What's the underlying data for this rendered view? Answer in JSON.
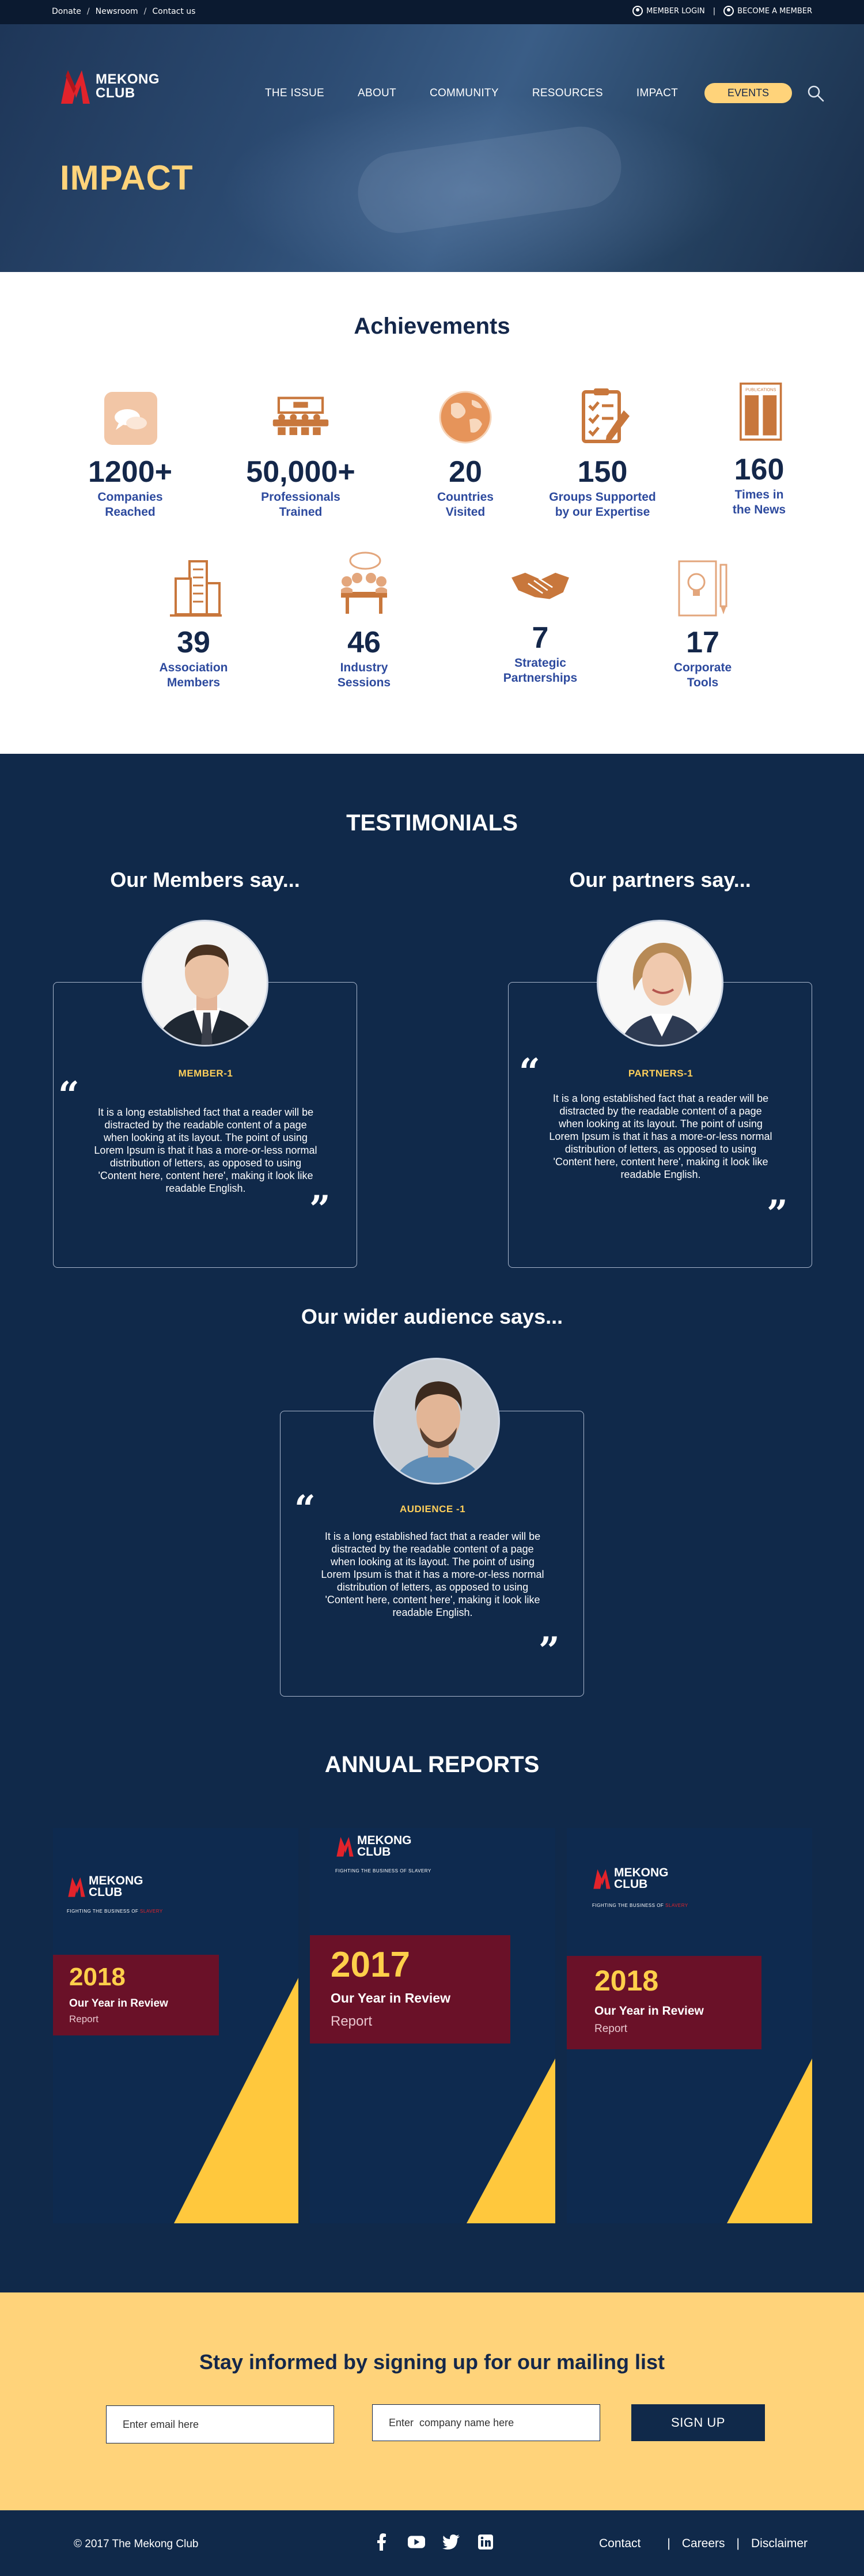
{
  "topbar": {
    "donate": "Donate",
    "newsroom": "Newsroom",
    "contact": "Contact us",
    "sep": "/",
    "member_login": "MEMBER LOGIN",
    "become_member": "BECOME A MEMBER",
    "pipe": "|"
  },
  "brand": {
    "line1": "MEKONG",
    "line2": "CLUB",
    "tagline_prefix": "FIGHTING THE BUSINESS OF",
    "tagline_accent": "SLAVERY",
    "color_red": "#e2232b"
  },
  "nav": {
    "items": [
      "THE ISSUE",
      "ABOUT",
      "COMMUNITY",
      "RESOURCES",
      "IMPACT"
    ],
    "events": "EVENTS"
  },
  "hero": {
    "title": "IMPACT"
  },
  "achievements": {
    "title": "Achievements",
    "stats": [
      {
        "number": "1200+",
        "label1": "Companies",
        "label2": "Reached",
        "icon": "chat-bubbles-icon"
      },
      {
        "number": "50,000+",
        "label1": "Professionals",
        "label2": "Trained",
        "icon": "training-board-icon"
      },
      {
        "number": "20",
        "label1": "Countries",
        "label2": "Visited",
        "icon": "globe-icon"
      },
      {
        "number": "150",
        "label1": "Groups Supported",
        "label2": "by our Expertise",
        "icon": "checklist-icon"
      },
      {
        "number": "160",
        "label1": "Times in",
        "label2": "the News",
        "icon": "publications-icon",
        "icon_text": "PUBLICATIONS"
      },
      {
        "number": "39",
        "label1": "Association",
        "label2": "Members",
        "icon": "buildings-icon"
      },
      {
        "number": "46",
        "label1": "Industry",
        "label2": "Sessions",
        "icon": "meeting-icon"
      },
      {
        "number": "7",
        "label1": "Strategic",
        "label2": "Partnerships",
        "icon": "handshake-icon"
      },
      {
        "number": "17",
        "label1": "Corporate",
        "label2": "Tools",
        "icon": "idea-tools-icon"
      }
    ]
  },
  "testimonials": {
    "title": "TESTIMONIALS",
    "members_heading": "Our Members say...",
    "partners_heading": "Our partners say...",
    "audience_heading": "Our wider audience says...",
    "quote_lines": [
      "It is a long established fact that a reader will be",
      "distracted by the readable content of a page",
      "when looking at its layout. The point of using",
      "Lorem Ipsum is that it has a more-or-less normal",
      "distribution of letters, as opposed to using",
      "'Content here, content here', making it look like",
      "readable English."
    ],
    "member_name": "MEMBER-1",
    "partner_name": "PARTNERS-1",
    "audience_name": "AUDIENCE -1"
  },
  "reports": {
    "title": "ANNUAL REPORTS",
    "items": [
      {
        "year": "2018",
        "subtitle": "Our Year in Review",
        "kind": "Report"
      },
      {
        "year": "2017",
        "subtitle": "Our Year in Review",
        "kind": "Report"
      },
      {
        "year": "2018",
        "subtitle": "Our Year in Review",
        "kind": "Report"
      }
    ]
  },
  "mailing": {
    "title": "Stay informed by signing up for our mailing list",
    "email_placeholder": "Enter email here",
    "company_placeholder": "Enter  company name here",
    "signup": "SIGN UP"
  },
  "footer": {
    "copyright": "© 2017 The Mekong Club",
    "links": [
      "Contact",
      "Careers",
      "Disclaimer"
    ],
    "sep": "|",
    "social": [
      "facebook-icon",
      "youtube-icon",
      "twitter-icon",
      "linkedin-icon"
    ]
  },
  "colors": {
    "navy": "#10294a",
    "gold": "#ffd37a",
    "accent_orange": "#c8773c",
    "stat_blue": "#2d4a9e",
    "report_maroon": "#6a1128",
    "triangle_yellow": "#ffc83d"
  }
}
